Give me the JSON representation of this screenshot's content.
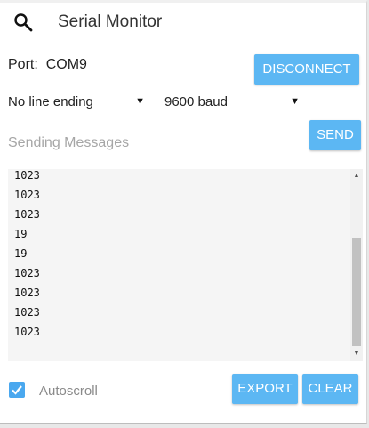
{
  "header": {
    "title": "Serial Monitor",
    "search_icon": "search-icon"
  },
  "connection": {
    "port_label": "Port:",
    "port_value": "COM9",
    "disconnect_label": "DISCONNECT"
  },
  "settings": {
    "line_ending": "No line ending",
    "baud_rate": "9600 baud"
  },
  "message": {
    "placeholder": "Sending Messages",
    "value": "",
    "send_label": "SEND"
  },
  "output": {
    "lines": [
      "1023",
      "1023",
      "1023",
      "19",
      "19",
      "1023",
      "1023",
      "1023",
      "1023"
    ]
  },
  "footer": {
    "autoscroll_label": "Autoscroll",
    "autoscroll_checked": true,
    "export_label": "EXPORT",
    "clear_label": "CLEAR"
  },
  "colors": {
    "accent": "#5cb7f3",
    "checkbox": "#4aa8ef",
    "output_background": "#f5f5f5"
  }
}
